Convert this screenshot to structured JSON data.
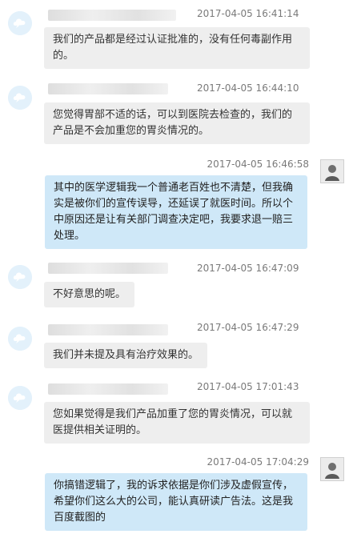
{
  "messages": [
    {
      "side": "agent",
      "time": "2017-04-05 16:41:14",
      "text": "我们的产品都是经过认证批准的，没有任何毒副作用的。"
    },
    {
      "side": "agent",
      "time": "2017-04-05 16:44:10",
      "text": "您觉得胃部不适的话，可以到医院去检查的，我们的产品是不会加重您的胃炎情况的。"
    },
    {
      "side": "user",
      "time": "2017-04-05 16:46:58",
      "text": "其中的医学逻辑我一个普通老百姓也不清楚，但我确实是被你们的宣传误导，还延误了就医时间。所以个中原因还是让有关部门调查决定吧，我要求退一赔三处理。"
    },
    {
      "side": "agent",
      "time": "2017-04-05 16:47:09",
      "text": "不好意思的呢。"
    },
    {
      "side": "agent",
      "time": "2017-04-05 16:47:29",
      "text": "我们并未提及具有治疗效果的。"
    },
    {
      "side": "agent",
      "time": "2017-04-05 17:01:43",
      "text": "您如果觉得是我们产品加重了您的胃炎情况，可以就医提供相关证明的。"
    },
    {
      "side": "user",
      "time": "2017-04-05 17:04:29",
      "text": "你搞错逻辑了，我的诉求依据是你们涉及虚假宣传，希望你们这么大的公司，能认真研读广告法。这是我百度截图的"
    }
  ],
  "colors": {
    "agent_bubble": "#eeeeee",
    "user_bubble": "#cfe8f8",
    "agent_avatar": "#e3f1fb"
  },
  "icons": {
    "agent_avatar": "cloud-chat-icon",
    "user_avatar": "user-photo-icon"
  }
}
